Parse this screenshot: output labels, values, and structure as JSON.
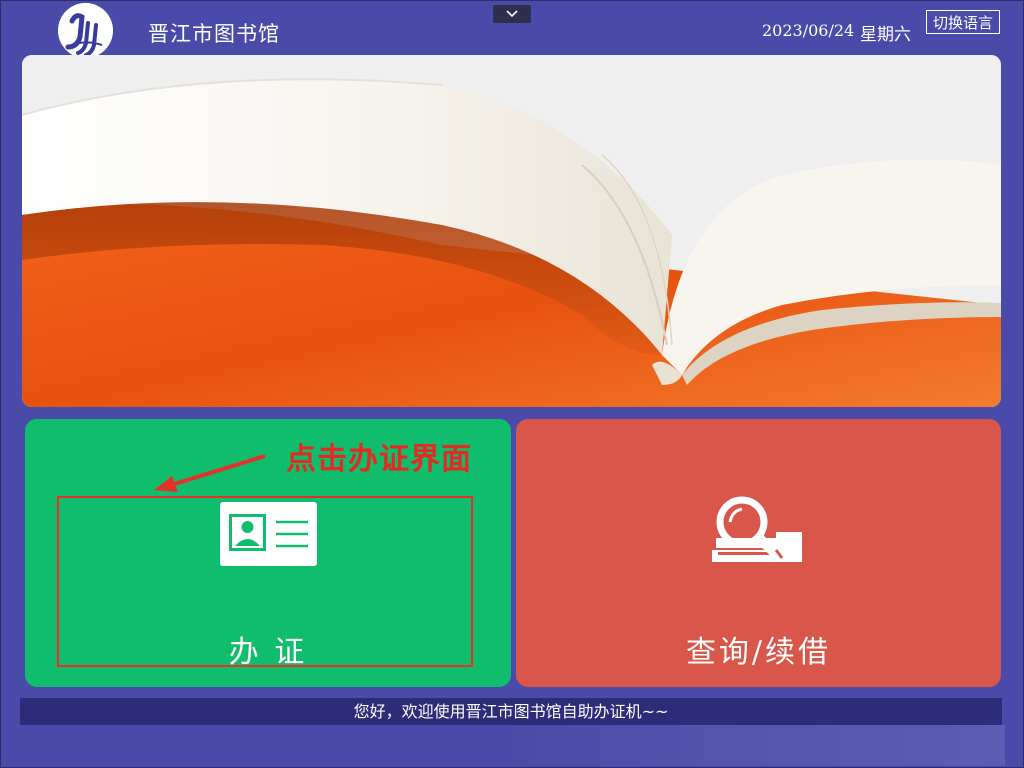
{
  "header": {
    "library_name": "晋江市图书馆",
    "date": "2023/06/24",
    "weekday": "星期六",
    "switch_language_label": "切换语言"
  },
  "tiles": {
    "card_label": "办 证",
    "query_label": "查询/续借"
  },
  "annotation": {
    "text": "点击办证界面"
  },
  "status_bar": {
    "message": "您好，欢迎使用晋江市图书馆自助办证机~~"
  },
  "colors": {
    "background": "#4a4aa8",
    "card_tile": "#10bd6c",
    "query_tile": "#d8574a",
    "annotation_red": "#e8302a",
    "status_bar": "#2c2c78"
  },
  "icons": {
    "dropdown": "chevron-down-icon",
    "logo": "library-logo",
    "id_card": "id-card-icon",
    "search_book": "book-search-icon"
  }
}
